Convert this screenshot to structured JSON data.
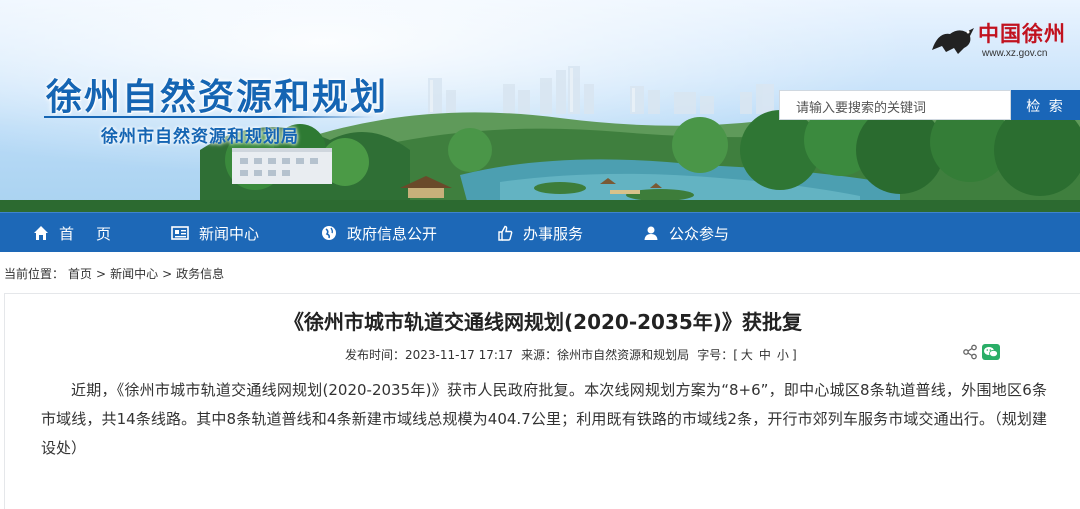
{
  "header": {
    "site_title": "徐州自然资源和规划",
    "site_subtitle": "徐州市自然资源和规划局",
    "logo_text": "中国徐州",
    "logo_url": "www.xz.gov.cn",
    "search": {
      "placeholder": "请输入要搜索的关键词",
      "button_label": "检 索"
    }
  },
  "nav": {
    "home": "首页",
    "news": "新闻中心",
    "gov_info": "政府信息公开",
    "services": "办事服务",
    "participation": "公众参与"
  },
  "breadcrumb": {
    "prefix": "当前位置：",
    "items": [
      "首页",
      "新闻中心",
      "政务信息"
    ],
    "separator": ">"
  },
  "article": {
    "title": "《徐州市城市轨道交通线网规划(2020-2035年)》获批复",
    "publish_label": "发布时间：",
    "publish_time": "2023-11-17 17:17",
    "source_label": "来源：",
    "source": "徐州市自然资源和规划局",
    "font_size_label": "字号：",
    "font_sizes": {
      "open": "[",
      "large": "大",
      "medium": "中",
      "small": "小",
      "close": "]"
    },
    "body": "近期，《徐州市城市轨道交通线网规划(2020-2035年)》获市人民政府批复。本次线网规划方案为“8+6”，即中心城区8条轨道普线，外围地区6条市域线，共14条线路。其中8条轨道普线和4条新建市域线总规模为404.7公里；利用既有铁路的市域线2条，开行市郊列车服务市域交通出行。（规划建设处）"
  },
  "colors": {
    "primary_blue": "#1d68b7",
    "title_blue": "#1565b3",
    "logo_red": "#c1121f",
    "wechat_green": "#2aae67"
  },
  "icons": [
    "home-icon",
    "news-icon",
    "globe-icon",
    "thumbs-up-icon",
    "user-icon",
    "share-icon",
    "wechat-icon"
  ]
}
